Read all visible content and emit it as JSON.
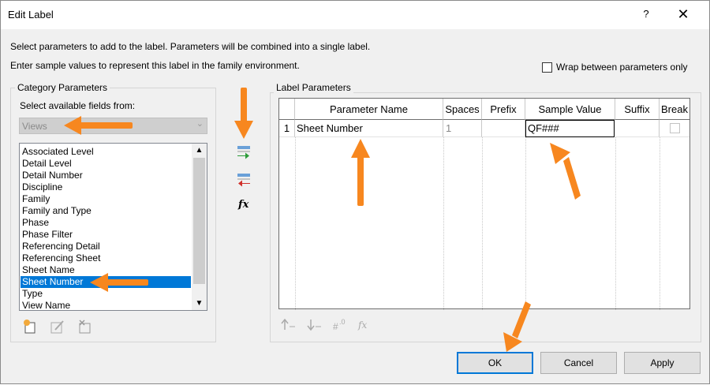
{
  "window": {
    "title": "Edit Label",
    "help_glyph": "?",
    "close_glyph": "✕"
  },
  "instructions": {
    "line1": "Select parameters to add to the label.  Parameters will be combined into a single label.",
    "line2": "Enter sample values to represent this label in the family environment."
  },
  "wrap_option": {
    "label": "Wrap between parameters only",
    "checked": false
  },
  "category": {
    "group_label": "Category Parameters",
    "select_label": "Select available fields from:",
    "selected": "Views",
    "fields": [
      "Associated Level",
      "Detail Level",
      "Detail Number",
      "Discipline",
      "Family",
      "Family and Type",
      "Phase",
      "Phase Filter",
      "Referencing Detail",
      "Referencing Sheet",
      "Sheet Name",
      "Sheet Number",
      "Type",
      "View Name"
    ],
    "selected_field": "Sheet Number"
  },
  "transfer_icons": [
    "add-parameter-icon",
    "remove-parameter-icon",
    "fx-icon"
  ],
  "fx_glyph": "fx",
  "label_params": {
    "group_label": "Label Parameters",
    "columns": [
      "Parameter Name",
      "Spaces",
      "Prefix",
      "Sample Value",
      "Suffix",
      "Break"
    ],
    "rows": [
      {
        "num": "1",
        "name": "Sheet Number",
        "spaces": "1",
        "prefix": "",
        "sample": "QF###",
        "suffix": "",
        "break": false
      }
    ]
  },
  "bottom_icons": [
    "move-up-icon",
    "move-down-icon",
    "edit-number-format-icon",
    "fx-icon"
  ],
  "buttons": {
    "ok": "OK",
    "cancel": "Cancel",
    "apply": "Apply"
  },
  "annotation_color": "#f7871f"
}
